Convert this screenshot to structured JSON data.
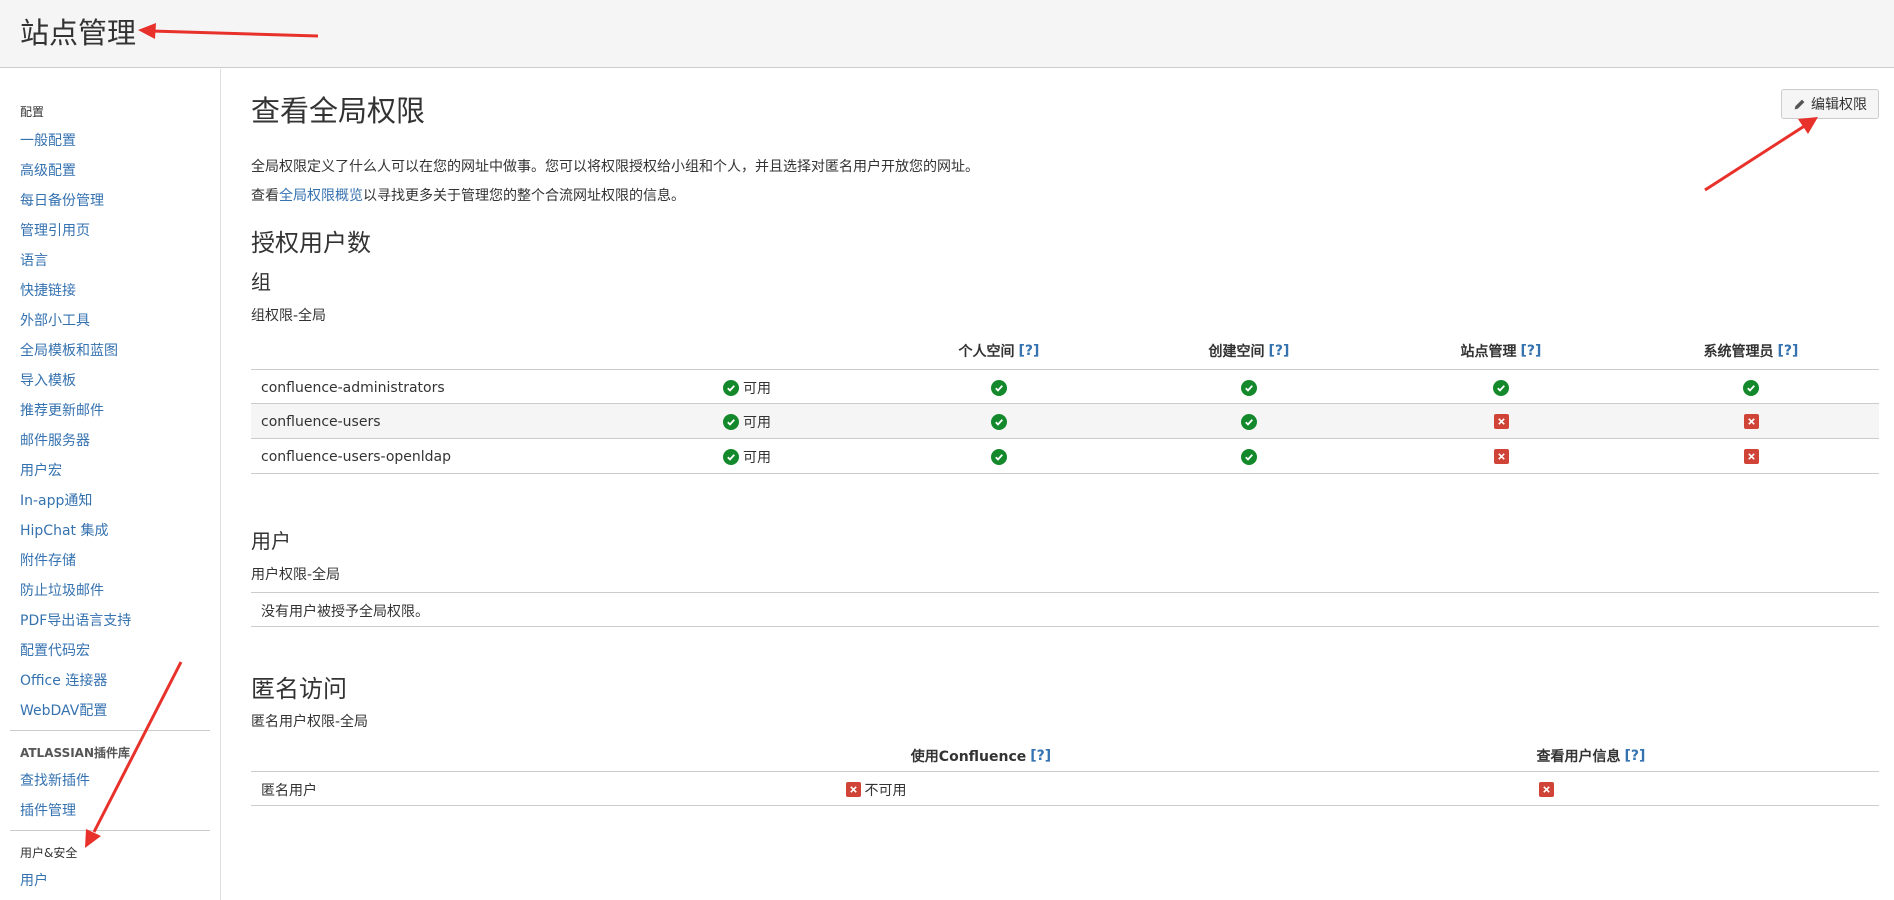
{
  "header": {
    "title": "站点管理"
  },
  "sidebar": {
    "sections": [
      {
        "label": "配置"
      },
      {
        "label": "ATLASSIAN插件库"
      },
      {
        "label": "用户&安全"
      }
    ],
    "config_items": [
      "一般配置",
      "高级配置",
      "每日备份管理",
      "管理引用页",
      "语言",
      "快捷链接",
      "外部小工具",
      "全局模板和蓝图",
      "导入模板",
      "推荐更新邮件",
      "邮件服务器",
      "用户宏",
      "In-app通知",
      "HipChat 集成",
      "附件存储",
      "防止垃圾邮件",
      "PDF导出语言支持",
      "配置代码宏",
      "Office 连接器",
      "WebDAV配置"
    ],
    "plugin_items": [
      "查找新插件",
      "插件管理"
    ],
    "security_items": [
      "用户"
    ]
  },
  "main": {
    "title": "查看全局权限",
    "edit_button": "编辑权限",
    "desc1": "全局权限定义了什么人可以在您的网址中做事。您可以将权限授权给小组和个人，并且选择对匿名用户开放您的网址。",
    "desc2_prefix": "查看",
    "desc2_link": "全局权限概览",
    "desc2_suffix": "以寻找更多关于管理您的整个合流网址权限的信息。",
    "licensed_title": "授权用户数",
    "groups_title": "组",
    "groups_caption": "组权限-全局",
    "help_text": "[?]",
    "group_columns": [
      "个人空间",
      "创建空间",
      "站点管理",
      "系统管理员"
    ],
    "groups": [
      {
        "name": "confluence-administrators",
        "status": "可用",
        "perms": [
          true,
          true,
          true,
          true
        ]
      },
      {
        "name": "confluence-users",
        "status": "可用",
        "perms": [
          true,
          true,
          false,
          false
        ]
      },
      {
        "name": "confluence-users-openldap",
        "status": "可用",
        "perms": [
          true,
          true,
          false,
          false
        ]
      }
    ],
    "users_title": "用户",
    "users_caption": "用户权限-全局",
    "users_empty": "没有用户被授予全局权限。",
    "anon_title": "匿名访问",
    "anon_caption": "匿名用户权限-全局",
    "anon_columns": [
      "使用Confluence",
      "查看用户信息"
    ],
    "anon_row": {
      "name": "匿名用户",
      "use_status": "不可用",
      "use": false,
      "view": false
    }
  },
  "colors": {
    "link": "#3572b0",
    "ok": "#14892c",
    "no": "#d04437",
    "annotation_arrow": "#e8312a"
  }
}
